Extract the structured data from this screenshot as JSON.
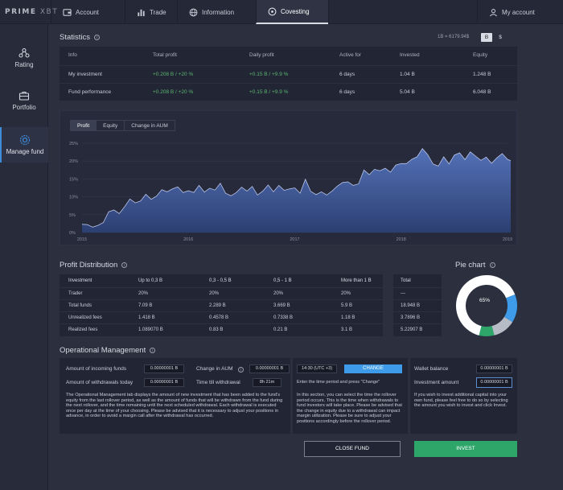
{
  "logo": {
    "brand": "PRIME",
    "suffix": "XBT"
  },
  "nav": {
    "tabs": [
      {
        "label": "Account",
        "icon": "wallet-icon"
      },
      {
        "label": "Trade",
        "icon": "chart-bars-icon"
      },
      {
        "label": "Information",
        "icon": "globe-icon"
      },
      {
        "label": "Covesting",
        "icon": "covesting-icon"
      }
    ],
    "account": "My account"
  },
  "sidebar": {
    "items": [
      {
        "label": "Rating",
        "icon": "rating-icon"
      },
      {
        "label": "Portfolio",
        "icon": "briefcase-icon"
      },
      {
        "label": "Manage fund",
        "icon": "gear-icon"
      }
    ]
  },
  "statistics": {
    "title": "Statistics",
    "rate": "1B = 6179.94$",
    "currency_btc": "B",
    "currency_usd": "$",
    "headers": [
      "Info",
      "Total profit",
      "Daily profit",
      "Active for",
      "Invested",
      "Equity"
    ],
    "rows": [
      [
        "My investment",
        "+0.208 B / +20 %",
        "+0.15 B / +9.9 %",
        "6 days",
        "1.04 B",
        "1.248 B"
      ],
      [
        "Fund performance",
        "+0.208 B / +20 %",
        "+0.15 B / +9.9 %",
        "6 days",
        "5.04 B",
        "6.048 B"
      ]
    ]
  },
  "chart": {
    "tabs": [
      "Profit",
      "Equity",
      "Change in AUM"
    ],
    "selected_tab": "Profit"
  },
  "chart_data": {
    "type": "area",
    "x_ticks": [
      "2015",
      "2016",
      "2017",
      "2018",
      "2019"
    ],
    "y_ticks": [
      "0%",
      "5%",
      "10%",
      "15%",
      "20%",
      "25%"
    ],
    "ylim": [
      0,
      25
    ],
    "xlim": [
      2015,
      2019
    ],
    "x": [
      2015.0,
      2015.05,
      2015.1,
      2015.15,
      2015.2,
      2015.25,
      2015.3,
      2015.35,
      2015.4,
      2015.45,
      2015.5,
      2015.55,
      2015.6,
      2015.65,
      2015.7,
      2015.75,
      2015.8,
      2015.85,
      2015.9,
      2015.95,
      2016.0,
      2016.05,
      2016.1,
      2016.15,
      2016.2,
      2016.25,
      2016.3,
      2016.35,
      2016.4,
      2016.45,
      2016.5,
      2016.55,
      2016.6,
      2016.65,
      2016.7,
      2016.75,
      2016.8,
      2016.85,
      2016.9,
      2016.95,
      2017.0,
      2017.05,
      2017.1,
      2017.15,
      2017.2,
      2017.25,
      2017.3,
      2017.35,
      2017.4,
      2017.45,
      2017.5,
      2017.55,
      2017.6,
      2017.65,
      2017.7,
      2017.75,
      2017.8,
      2017.85,
      2017.9,
      2017.95,
      2018.0,
      2018.05,
      2018.1,
      2018.15,
      2018.2,
      2018.25,
      2018.3,
      2018.35,
      2018.4,
      2018.45,
      2018.5,
      2018.55,
      2018.6,
      2018.65,
      2018.7,
      2018.75,
      2018.8,
      2018.85,
      2018.9,
      2018.95,
      2019.0,
      2019.03
    ],
    "values": [
      2.3,
      2.2,
      1.5,
      2.0,
      2.8,
      5.8,
      6.3,
      5.3,
      7.2,
      9.4,
      8.3,
      8.8,
      10.7,
      9.3,
      10.2,
      12.0,
      11.4,
      12.2,
      12.8,
      11.2,
      11.7,
      11.2,
      13.2,
      11.3,
      12.4,
      11.9,
      13.8,
      11.0,
      10.3,
      11.2,
      12.7,
      11.6,
      12.9,
      10.5,
      11.6,
      13.3,
      11.4,
      13.2,
      11.8,
      12.2,
      12.5,
      11.0,
      14.9,
      11.5,
      10.6,
      11.4,
      10.5,
      11.6,
      13.0,
      14.0,
      14.2,
      13.2,
      13.6,
      17.5,
      16.2,
      17.7,
      17.3,
      18.0,
      16.9,
      18.9,
      19.3,
      19.3,
      20.5,
      21.2,
      23.5,
      21.8,
      19.2,
      18.6,
      21.2,
      19.2,
      21.7,
      22.3,
      20.4,
      22.6,
      21.4,
      20.2,
      21.1,
      19.4,
      20.9,
      22.1,
      20.5,
      20.1
    ]
  },
  "profit_distribution": {
    "title": "Profit Distribution",
    "headers": [
      "Investment",
      "Up to 0,3 B",
      "0,3 - 0,5 B",
      "0,5 - 1 B",
      "More than 1 B"
    ],
    "rows": [
      [
        "Trader",
        "20%",
        "20%",
        "20%",
        "20%"
      ],
      [
        "Total funds",
        "7.09 B",
        "2.289 B",
        "3.669 B",
        "5.9 B"
      ],
      [
        "Unrealized fees",
        "1.418 B",
        "0.4578 B",
        "0.7338 B",
        "1.18 B"
      ],
      [
        "Realized fees",
        "1.089070 B",
        "0.83 B",
        "0.21 B",
        "3.1 B"
      ]
    ],
    "total_header": "Total",
    "totals": [
      "—",
      "18.948 B",
      "3.7896 B",
      "5.22907 B"
    ]
  },
  "pie": {
    "title": "Pie chart",
    "label": "65%",
    "slices": [
      {
        "value": 65,
        "color": "#ffffff"
      },
      {
        "value": 15,
        "color": "#3d9be9"
      },
      {
        "value": 12,
        "color": "#b6bcc6"
      },
      {
        "value": 8,
        "color": "#2ea66a"
      }
    ]
  },
  "operational": {
    "title": "Operational Management",
    "incoming_label": "Amount of incoming funds",
    "incoming_value": "0.00000001 B",
    "aum_label": "Change in AUM",
    "aum_value": "0.00000001 B",
    "withdrawals_label": "Amount of withdrawals today",
    "withdrawals_value": "0.00000001 B",
    "time_label": "Time till withdrawal",
    "time_value": "8h 21m",
    "description": "The Operational Management tab displays the amount of new investment that has been added to the fund's equity from the last rollover period, as well as the amount of funds that will be withdrawn from the fund during the next rollover, and the time remaining until the next scheduled withdrawal. Each withdrawal is executed once per day at the time of your choosing. Please be advised that it is necessary to adjust your positions in advance, in order to avoid a margin call after the withdrawal has occurred.",
    "rollover_time": "14:30 (UTC +3)",
    "change_label": "CHANGE",
    "rollover_hint": "Enter the time period and press \"Change\"",
    "rollover_text": "In this section, you can select the time the rollover period occurs. This is the time when withdrawals to fund investors will take place. Please be advised that the change in equity due to a withdrawal can impact margin utilization. Please be sure to adjust your positions accordingly before the rollover period.",
    "wallet_label": "Wallet balance",
    "wallet_value": "0.00000001 B",
    "invest_amount_label": "Investment amount",
    "invest_amount_value": "0.00000001 B",
    "invest_text": "If you wish to invest additional capital into your own fund, please feel free to do so by selecting the amount you wish to invest and click Invest.",
    "close_fund": "CLOSE FUND",
    "invest": "INVEST"
  }
}
